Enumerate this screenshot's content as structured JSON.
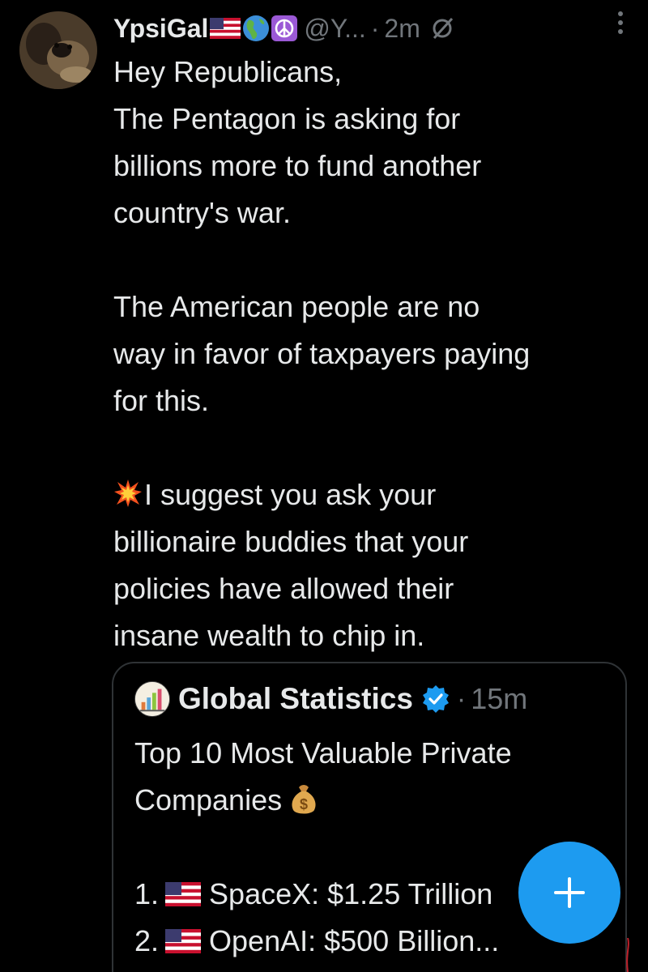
{
  "tweet": {
    "display_name": "YpsiGal",
    "name_emojis": [
      "us-flag-icon",
      "globe-americas-icon",
      "peace-symbol-icon"
    ],
    "handle": "@Y...",
    "separator": "·",
    "time": "2m",
    "paragraphs": [
      "Hey Republicans,\nThe Pentagon is asking for\nbillions more to fund another\ncountry's war.",
      "The American people are no\nway in favor of taxpayers paying\nfor this.",
      "I suggest you ask your\nbillionaire buddies that your\npolicies have allowed their\ninsane wealth to chip in."
    ]
  },
  "quote": {
    "author": "Global Statistics",
    "verified": true,
    "separator": "·",
    "time": "15m",
    "title_line1": "Top 10 Most Valuable Private",
    "title_line2": "Companies",
    "items": [
      {
        "num": "1.",
        "text": "SpaceX: $1.25 Trillion"
      },
      {
        "num": "2.",
        "text": "OpenAI: $500 Billion..."
      }
    ]
  },
  "colors": {
    "background": "#000000",
    "text": "#e7e9ea",
    "muted": "#71767b",
    "accent": "#1d9bf0",
    "border": "#2f3336"
  },
  "icons": {
    "fab": "plus-icon",
    "more": "more-vertical-icon",
    "audience": "no-signal-icon"
  }
}
